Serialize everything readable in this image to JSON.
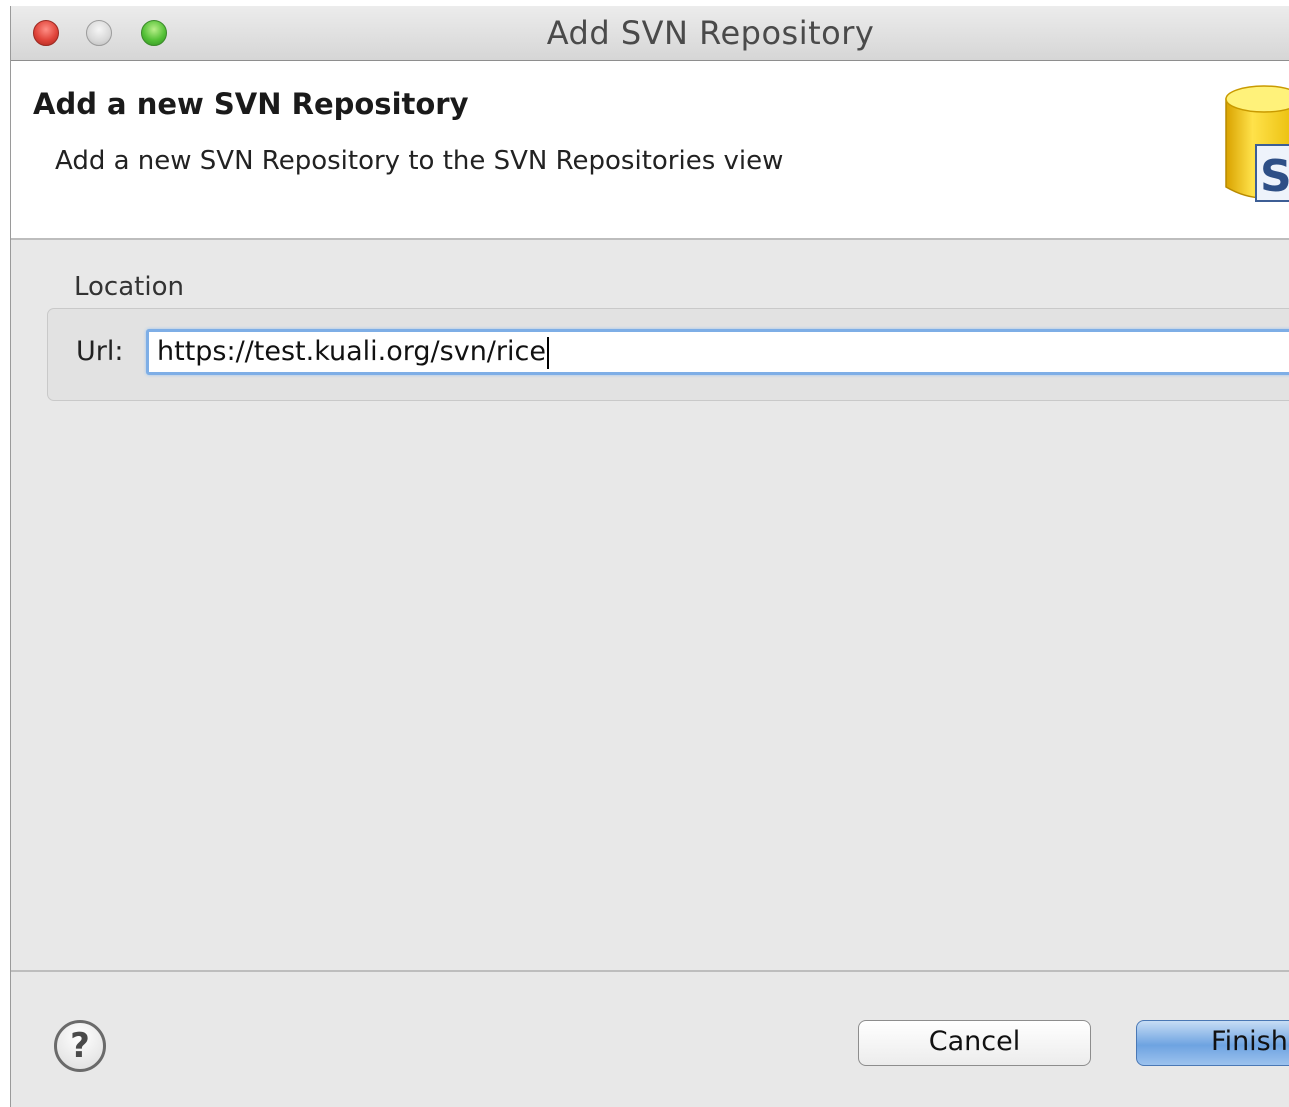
{
  "window": {
    "title": "Add SVN Repository"
  },
  "header": {
    "heading": "Add a new SVN Repository",
    "description": "Add a new SVN Repository to the SVN Repositories view",
    "logo_icon": "svn-repository-icon"
  },
  "location": {
    "group_label": "Location",
    "url_label": "Url:",
    "url_value": "https://test.kuali.org/svn/rice"
  },
  "footer": {
    "help_icon": "help-icon",
    "help_glyph": "?",
    "cancel_label": "Cancel",
    "finish_label": "Finish"
  },
  "colors": {
    "close": "#e0443a",
    "minimize": "#d8d8d8",
    "zoom": "#55c137",
    "focus_ring": "#7eaee6",
    "default_button": "#6ea3e1"
  }
}
